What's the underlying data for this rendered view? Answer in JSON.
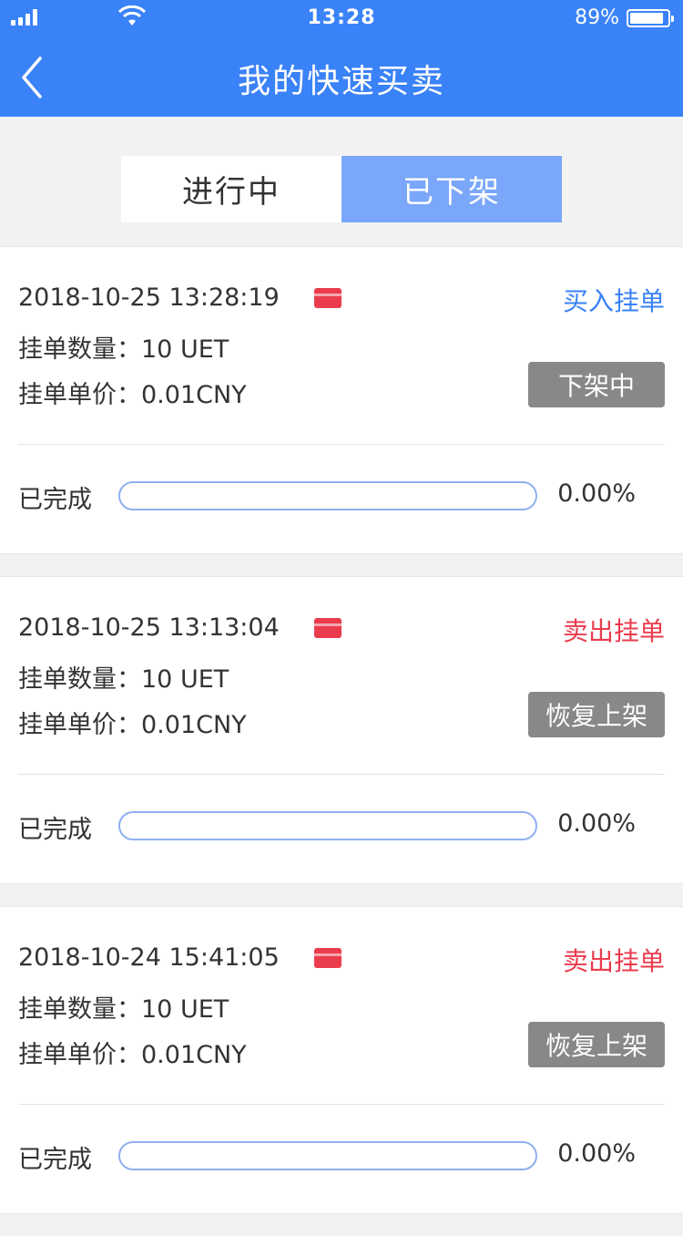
{
  "status_bar": {
    "time": "13:28",
    "battery": "89%"
  },
  "nav": {
    "title": "我的快速买卖"
  },
  "tabs": [
    {
      "label": "进行中",
      "active": false
    },
    {
      "label": "已下架",
      "active": true
    }
  ],
  "orders": [
    {
      "datetime": "2018-10-25 13:28:19",
      "type_label": "买入挂单",
      "type": "buy",
      "quantity": "挂单数量：10 UET",
      "price": "挂单单价：0.01CNY",
      "action": "下架中",
      "done_label": "已完成",
      "progress_text": "0.00%",
      "progress": 0
    },
    {
      "datetime": "2018-10-25 13:13:04",
      "type_label": "卖出挂单",
      "type": "sell",
      "quantity": "挂单数量：10 UET",
      "price": "挂单单价：0.01CNY",
      "action": "恢复上架",
      "done_label": "已完成",
      "progress_text": "0.00%",
      "progress": 0
    },
    {
      "datetime": "2018-10-24 15:41:05",
      "type_label": "卖出挂单",
      "type": "sell",
      "quantity": "挂单数量：10 UET",
      "price": "挂单单价：0.01CNY",
      "action": "恢复上架",
      "done_label": "已完成",
      "progress_text": "0.00%",
      "progress": 0
    }
  ],
  "colors": {
    "primary": "#3a82f7",
    "sell": "#ea3c4d",
    "tab_active": "#7aa7fa",
    "button_gray": "#888888"
  }
}
